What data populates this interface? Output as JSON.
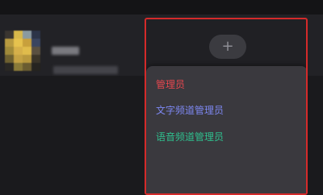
{
  "member": {
    "avatar_colors": [
      "#3a3530",
      "#d8b84a",
      "#8a9aa0",
      "#2c3448",
      "#b89a40",
      "#e6c24e",
      "#c8a03c",
      "#3a4560",
      "#a08a3a",
      "#d6b04a",
      "#e0bc4c",
      "#5a5040",
      "#6e6030",
      "#c4a244",
      "#b8983e",
      "#3a3428",
      "#2a2824",
      "#8a7a38",
      "#6a5c30",
      "#262420"
    ]
  },
  "panel": {
    "highlight_color": "#d42a2a",
    "add_button": {
      "icon": "plus-icon",
      "glyph": "+"
    },
    "roles": [
      {
        "label": "管理员",
        "color": "#e5474f"
      },
      {
        "label": "文字频道管理员",
        "color": "#7d87f0"
      },
      {
        "label": "语音频道管理员",
        "color": "#2fbf8e"
      }
    ]
  }
}
